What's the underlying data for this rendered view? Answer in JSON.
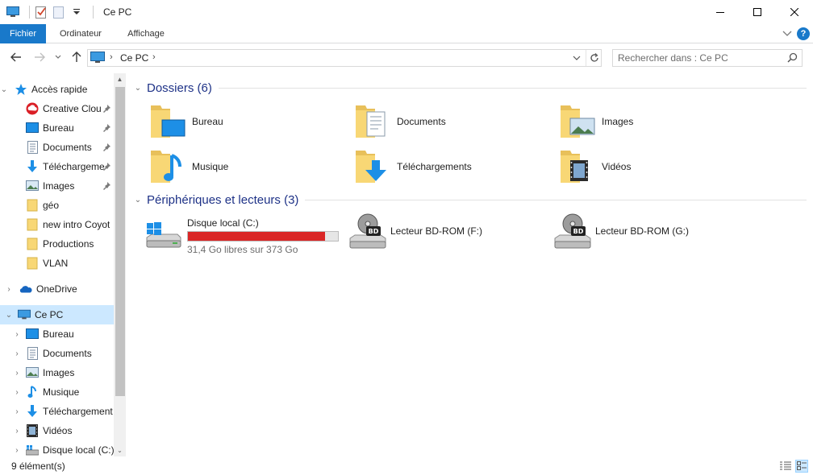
{
  "window": {
    "title": "Ce PC"
  },
  "ribbon": {
    "tabs": [
      "Fichier",
      "Ordinateur",
      "Affichage"
    ]
  },
  "address": {
    "path": "Ce PC"
  },
  "search": {
    "placeholder": "Rechercher dans : Ce PC"
  },
  "nav": {
    "quick_access": "Accès rapide",
    "pinned": [
      {
        "label": "Creative Clou",
        "icon": "creative-cloud-icon"
      },
      {
        "label": "Bureau",
        "icon": "desktop-icon"
      },
      {
        "label": "Documents",
        "icon": "documents-icon"
      },
      {
        "label": "Téléchargeme",
        "icon": "downloads-icon"
      },
      {
        "label": "Images",
        "icon": "pictures-icon"
      }
    ],
    "folders": [
      "géo",
      "new intro Coyot",
      "Productions",
      "VLAN"
    ],
    "onedrive": "OneDrive",
    "this_pc": "Ce PC",
    "this_pc_children": [
      {
        "label": "Bureau",
        "icon": "desktop-icon"
      },
      {
        "label": "Documents",
        "icon": "documents-icon"
      },
      {
        "label": "Images",
        "icon": "pictures-icon"
      },
      {
        "label": "Musique",
        "icon": "music-icon"
      },
      {
        "label": "Téléchargement",
        "icon": "downloads-icon"
      },
      {
        "label": "Vidéos",
        "icon": "videos-icon"
      },
      {
        "label": "Disque local (C:)",
        "icon": "local-disk-icon"
      }
    ]
  },
  "content": {
    "folders_header": "Dossiers (6)",
    "folders": [
      {
        "label": "Bureau",
        "icon": "desktop-folder-icon"
      },
      {
        "label": "Documents",
        "icon": "documents-folder-icon"
      },
      {
        "label": "Images",
        "icon": "pictures-folder-icon"
      },
      {
        "label": "Musique",
        "icon": "music-folder-icon"
      },
      {
        "label": "Téléchargements",
        "icon": "downloads-folder-icon"
      },
      {
        "label": "Vidéos",
        "icon": "videos-folder-icon"
      }
    ],
    "devices_header": "Périphériques et lecteurs (3)",
    "drives": [
      {
        "label": "Disque local (C:)",
        "free": "31,4 Go libres sur 373 Go",
        "used_fraction": 0.916,
        "icon": "windows-drive-icon"
      },
      {
        "label": "Lecteur BD-ROM (F:)",
        "icon": "bd-rom-drive-icon"
      },
      {
        "label": "Lecteur BD-ROM (G:)",
        "icon": "bd-rom-drive-icon"
      }
    ]
  },
  "status": {
    "item_count": "9 élément(s)"
  },
  "colors": {
    "accent": "#1979ca",
    "selection": "#cce8ff",
    "drive_bar": "#da2626",
    "folder_yellow": "#f8d775",
    "group_header": "#1e3287"
  }
}
